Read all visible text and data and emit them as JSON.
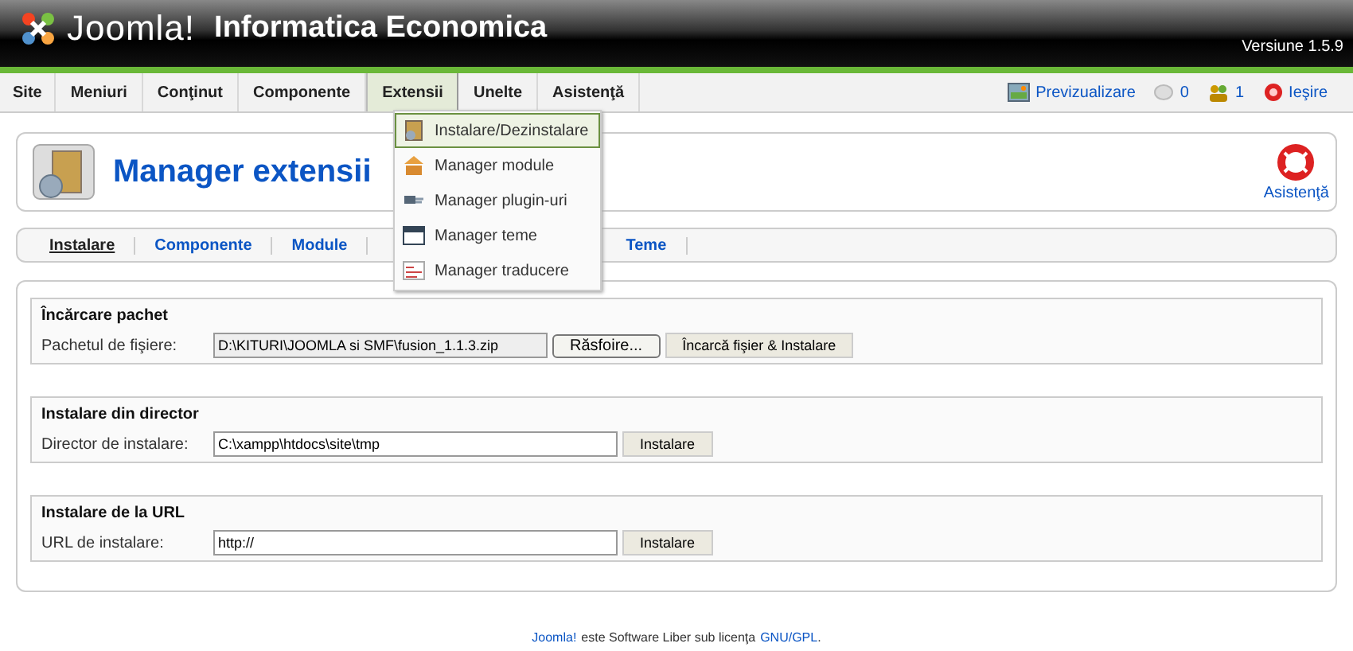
{
  "header": {
    "logo": "Joomla!",
    "site_name": "Informatica Economica",
    "version": "Versiune 1.5.9"
  },
  "menu": [
    {
      "label": "Site",
      "selected": false
    },
    {
      "label": "Meniuri",
      "selected": false
    },
    {
      "label": "Conţinut",
      "selected": false
    },
    {
      "label": "Componente",
      "selected": false
    },
    {
      "label": "Extensii",
      "selected": true
    },
    {
      "label": "Unelte",
      "selected": false
    },
    {
      "label": "Asistenţă",
      "selected": false
    }
  ],
  "status": {
    "preview": "Previzualizare",
    "messages": "0",
    "users": "1",
    "logout": "Ieşire"
  },
  "dropdown": [
    {
      "label": "Instalare/Dezinstalare",
      "selected": true,
      "kind": "install"
    },
    {
      "label": "Manager module",
      "selected": false,
      "kind": "module"
    },
    {
      "label": "Manager plugin-uri",
      "selected": false,
      "kind": "plugin"
    },
    {
      "label": "Manager teme",
      "selected": false,
      "kind": "template"
    },
    {
      "label": "Manager traducere",
      "selected": false,
      "kind": "language"
    }
  ],
  "toolbar": {
    "title": "Manager extensii",
    "help": "Asistenţă"
  },
  "subtabs": [
    {
      "label": "Instalare",
      "selected": true
    },
    {
      "label": "Componente",
      "selected": false
    },
    {
      "label": "Module",
      "selected": false
    },
    {
      "label": "Teme",
      "selected": false
    }
  ],
  "sections": [
    {
      "title": "Încărcare pachet",
      "label": "Pachetul de fişiere:",
      "value": "D:\\KITURI\\JOOMLA si SMF\\fusion_1.1.3.zip",
      "kind": "file",
      "browse": "Răsfoire...",
      "button": "Încarcă fişier & Instalare"
    },
    {
      "title": "Instalare din director",
      "label": "Director de instalare:",
      "value": "C:\\xampp\\htdocs\\site\\tmp",
      "kind": "text",
      "button": "Instalare"
    },
    {
      "title": "Instalare de la URL",
      "label": "URL de instalare:",
      "value": "http://",
      "kind": "text",
      "button": "Instalare"
    }
  ],
  "footer": {
    "link": "Joomla!",
    "text": "este Software Liber sub licenţa",
    "license": "GNU/GPL",
    "end": "."
  }
}
